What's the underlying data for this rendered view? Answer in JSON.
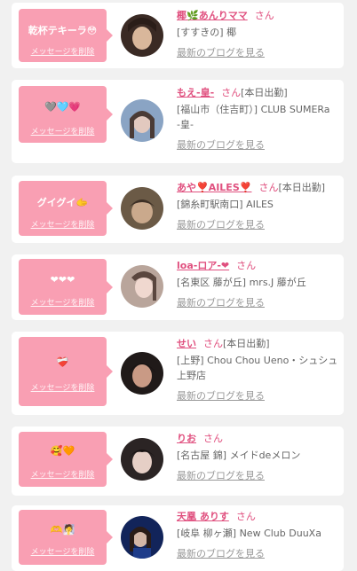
{
  "delete_label": "メッセージを削除",
  "blog_label": "最新のブログを見る",
  "san": "さん",
  "cards": [
    {
      "message": "乾杯テキーラ😳",
      "name": "椰🌿あんりママ",
      "extra": "",
      "shop": "[すすきの] 椰",
      "colors": [
        "#3a2a24",
        "#d9b79b"
      ]
    },
    {
      "message": "🩶🩵💗",
      "name": "もえ-皇-",
      "extra": "[本日出勤]",
      "shop": "[福山市（住吉町）] CLUB SUMERa -皇-",
      "colors": [
        "#8aa4c4",
        "#e2c9bf"
      ]
    },
    {
      "message": "グイグイ🫱",
      "name": "あや❣️AILES❣️",
      "extra": "[本日出勤]",
      "shop": "[錦糸町駅南口] AILES",
      "colors": [
        "#6b5a46",
        "#caa98c"
      ]
    },
    {
      "message": "❤❤❤",
      "name": "loa-ロア-❤",
      "extra": "",
      "shop": "[名東区 藤が丘] mrs.J 藤が丘",
      "colors": [
        "#b9a59b",
        "#f0d8cf"
      ]
    },
    {
      "message": "❤️‍🩹",
      "name": "せい",
      "extra": "[本日出勤]",
      "shop": "[上野] Chou Chou Ueno・シュシュ上野店",
      "colors": [
        "#201a19",
        "#c99a85"
      ]
    },
    {
      "message": "🥰🧡",
      "name": "りお",
      "extra": "",
      "shop": "[名古屋 錦] メイドdeメロン",
      "colors": [
        "#2b2424",
        "#e6cfc6"
      ]
    },
    {
      "message": "🫶🧖",
      "name": "天凰 ありす",
      "extra": "",
      "shop": "[岐阜 柳ヶ瀬] New Club DuuXa",
      "colors": [
        "#12245a",
        "#d3b6a7"
      ]
    }
  ]
}
